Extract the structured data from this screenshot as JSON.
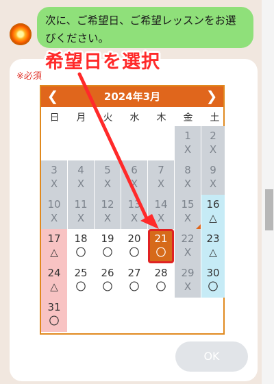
{
  "chat": {
    "message": "次に、ご希望日、ご希望レッスンをお選びください。"
  },
  "form": {
    "required_label": "※必須",
    "ok_label": "OK"
  },
  "annotation": {
    "text": "希望日を選択",
    "color": "#ff2a2a"
  },
  "calendar": {
    "title": "2024年3月",
    "prev_icon": "chevron-left-icon",
    "next_icon": "chevron-right-icon",
    "weekdays": [
      "日",
      "月",
      "火",
      "水",
      "木",
      "金",
      "土"
    ],
    "days": [
      {
        "day": "1",
        "status": "X",
        "kind": "unavailable"
      },
      {
        "day": "2",
        "status": "X",
        "kind": "unavailable"
      },
      {
        "day": "3",
        "status": "X",
        "kind": "unavailable"
      },
      {
        "day": "4",
        "status": "X",
        "kind": "unavailable"
      },
      {
        "day": "5",
        "status": "X",
        "kind": "unavailable"
      },
      {
        "day": "6",
        "status": "X",
        "kind": "unavailable"
      },
      {
        "day": "7",
        "status": "X",
        "kind": "unavailable"
      },
      {
        "day": "8",
        "status": "X",
        "kind": "unavailable"
      },
      {
        "day": "9",
        "status": "X",
        "kind": "unavailable"
      },
      {
        "day": "10",
        "status": "X",
        "kind": "unavailable"
      },
      {
        "day": "11",
        "status": "X",
        "kind": "unavailable"
      },
      {
        "day": "12",
        "status": "X",
        "kind": "unavailable"
      },
      {
        "day": "13",
        "status": "X",
        "kind": "unavailable"
      },
      {
        "day": "14",
        "status": "X",
        "kind": "unavailable"
      },
      {
        "day": "15",
        "status": "X",
        "kind": "unavailable"
      },
      {
        "day": "16",
        "status": "△",
        "kind": "saturday"
      },
      {
        "day": "17",
        "status": "△",
        "kind": "sunday"
      },
      {
        "day": "18",
        "status": "〇",
        "kind": "available"
      },
      {
        "day": "19",
        "status": "〇",
        "kind": "available"
      },
      {
        "day": "20",
        "status": "〇",
        "kind": "available"
      },
      {
        "day": "21",
        "status": "〇",
        "kind": "selected"
      },
      {
        "day": "22",
        "status": "X",
        "kind": "unavailable"
      },
      {
        "day": "23",
        "status": "△",
        "kind": "saturday"
      },
      {
        "day": "24",
        "status": "△",
        "kind": "sunday"
      },
      {
        "day": "25",
        "status": "〇",
        "kind": "available"
      },
      {
        "day": "26",
        "status": "〇",
        "kind": "available"
      },
      {
        "day": "27",
        "status": "〇",
        "kind": "available"
      },
      {
        "day": "28",
        "status": "〇",
        "kind": "available"
      },
      {
        "day": "29",
        "status": "X",
        "kind": "unavailable"
      },
      {
        "day": "30",
        "status": "〇",
        "kind": "saturday"
      },
      {
        "day": "31",
        "status": "〇",
        "kind": "sunday"
      }
    ]
  }
}
